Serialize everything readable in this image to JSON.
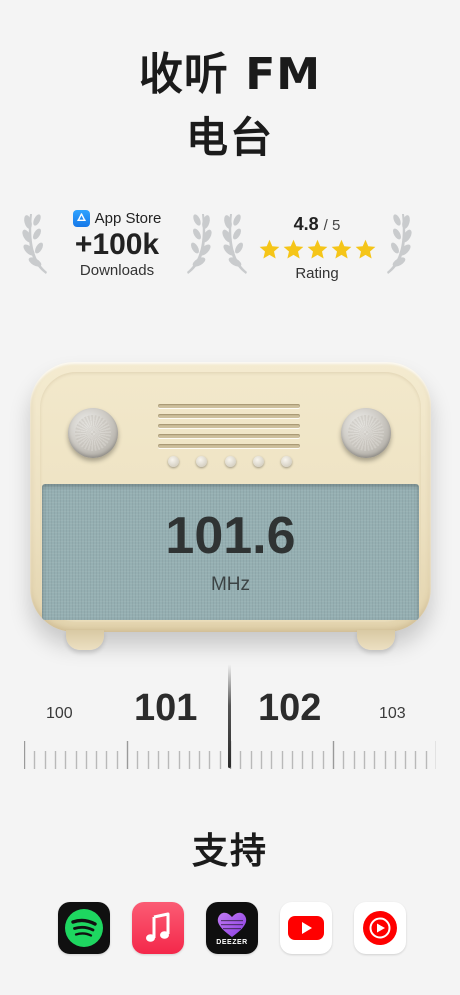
{
  "header": {
    "title_line1": "收听 FM",
    "title_line2": "电台"
  },
  "stats": {
    "downloads": {
      "store_label": "App Store",
      "value": "+100k",
      "label": "Downloads"
    },
    "rating": {
      "score": "4.8",
      "denominator": "/ 5",
      "stars": 5,
      "label": "Rating",
      "star_color": "#f5c518"
    }
  },
  "radio": {
    "frequency": "101.6",
    "unit": "MHz",
    "screen_color": "#95afb2",
    "body_color": "#efe4c6"
  },
  "dial": {
    "labels": [
      "100",
      "101",
      "102",
      "103"
    ],
    "current": 101.6
  },
  "support": {
    "title": "支持",
    "apps": [
      "spotify-icon",
      "apple-music-icon",
      "deezer-icon",
      "youtube-icon",
      "youtube-music-icon"
    ],
    "deezer_label": "DEEZER"
  }
}
